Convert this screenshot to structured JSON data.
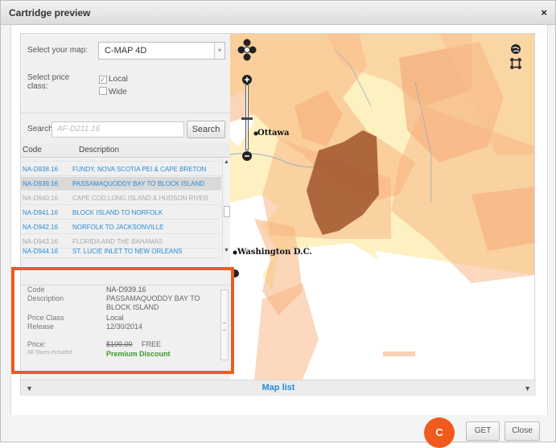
{
  "dialog": {
    "title": "Cartridge preview",
    "close_symbol": "×"
  },
  "form": {
    "map_label": "Select your map:",
    "map_value": "C-MAP 4D",
    "price_class_label_1": "Select price",
    "price_class_label_2": "class:",
    "option_local": "Local",
    "option_wide": "Wide",
    "search_label": "Search:",
    "search_placeholder": "AF-D211.16",
    "search_button": "Search"
  },
  "list": {
    "col_code": "Code",
    "col_description": "Description",
    "rows": [
      {
        "code": "NA-D938.16",
        "desc": "FUNDY, NOVA SCOTIA PEI & CAPE BRETON",
        "state": "blue"
      },
      {
        "code": "NA-D939.16",
        "desc": "PASSAMAQUODDY BAY TO BLOCK ISLAND",
        "state": "selected"
      },
      {
        "code": "NA-D940.16",
        "desc": "CAPE COD,LONG ISLAND & HUDSON RIVER",
        "state": "grey"
      },
      {
        "code": "NA-D941.16",
        "desc": "BLOCK ISLAND TO NORFOLK",
        "state": "blue"
      },
      {
        "code": "NA-D942.16",
        "desc": "NORFOLK TO JACKSONVILLE",
        "state": "blue"
      },
      {
        "code": "NA-D943.16",
        "desc": "FLORIDA AND THE BAHAMAS",
        "state": "grey"
      },
      {
        "code": "NA-D944.16",
        "desc": "ST. LUCIE INLET TO NEW ORLEANS",
        "state": "blue"
      }
    ]
  },
  "details": {
    "code_label": "Code",
    "code_value": "NA-D939.16",
    "description_label": "Description",
    "description_value_1": "PASSAMAQUODDY BAY TO",
    "description_value_2": "BLOCK ISLAND",
    "price_class_label": "Price Class",
    "price_class_value": "Local",
    "release_label": "Release",
    "release_value": "12/30/2014",
    "price_label": "Price:",
    "taxes_note": "All Taxes included",
    "old_price": "$199.00",
    "new_price": "FREE",
    "discount_text": "Premium Discount"
  },
  "map": {
    "label_ottawa": "Ottawa",
    "label_washington": "Washington D.C.",
    "footer_label": "Map list"
  },
  "footer": {
    "badge": "C",
    "get_button": "GET",
    "close_button": "Close"
  },
  "colors": {
    "accent_orange": "#f05a1f",
    "link_blue": "#2a8ad4",
    "discount_green": "#3a9a2a",
    "map_land": "#fdf1c2",
    "map_chart_area": "#f7b27e",
    "map_selected_area": "#a0532b"
  },
  "icons": [
    "close-icon",
    "dropdown-arrow-icon",
    "checkbox-icon",
    "pan-control-icon",
    "zoom-in-icon",
    "zoom-out-icon",
    "globe-icon",
    "fullscreen-icon",
    "scroll-up-icon",
    "scroll-down-icon"
  ]
}
